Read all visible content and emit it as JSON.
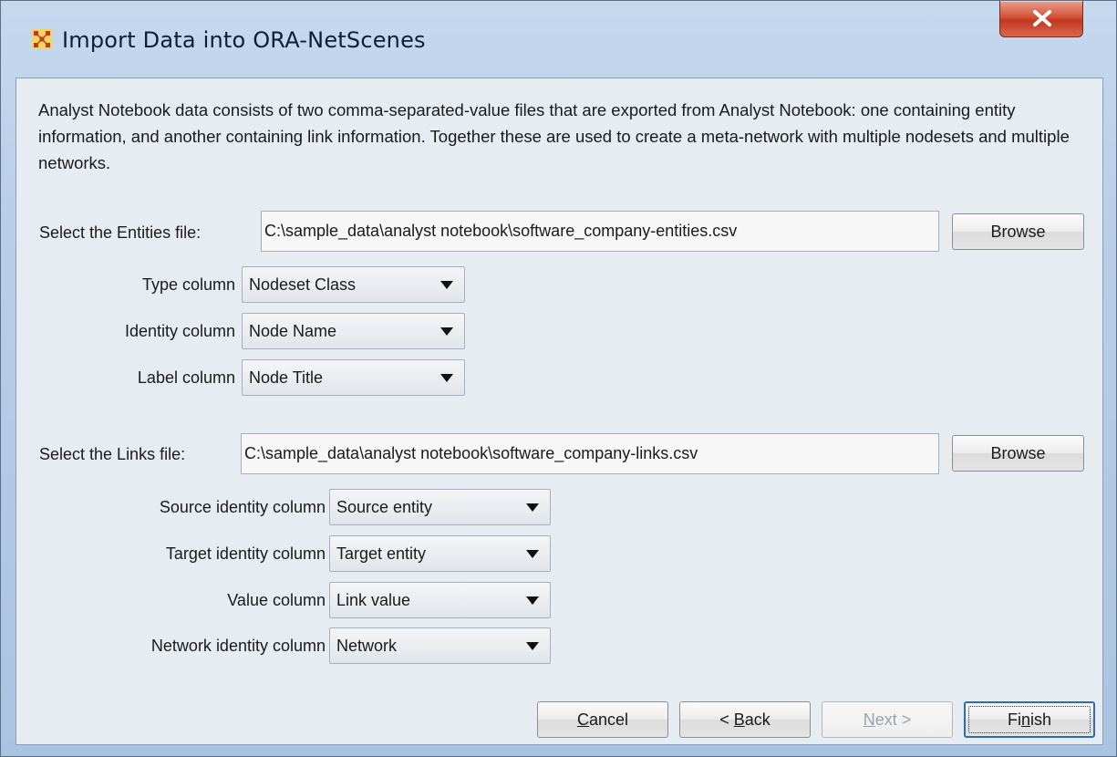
{
  "window": {
    "title": "Import Data into ORA-NetScenes"
  },
  "description": "Analyst Notebook data consists of two comma-separated-value files that are exported from Analyst Notebook: one containing entity information, and another containing link information. Together these are used to create a meta-network with multiple nodesets and multiple networks.",
  "entities": {
    "file_label": "Select the Entities file:",
    "file_value": "C:\\sample_data\\analyst notebook\\software_company-entities.csv",
    "browse_label": "Browse",
    "type_label": "Type column",
    "type_value": "Nodeset Class",
    "identity_label": "Identity column",
    "identity_value": "Node Name",
    "label_label": "Label column",
    "label_value": "Node Title"
  },
  "links": {
    "file_label": "Select the Links file:",
    "file_value": "C:\\sample_data\\analyst notebook\\software_company-links.csv",
    "browse_label": "Browse",
    "source_label": "Source identity column",
    "source_value": "Source entity",
    "target_label": "Target identity column",
    "target_value": "Target entity",
    "value_label": "Value column",
    "value_value": "Link value",
    "network_label": "Network identity column",
    "network_value": "Network"
  },
  "buttons": {
    "cancel": {
      "pre": "",
      "mnemonic": "C",
      "post": "ancel"
    },
    "back": {
      "pre": "< ",
      "mnemonic": "B",
      "post": "ack"
    },
    "next": {
      "pre": "",
      "mnemonic": "N",
      "post": "ext >"
    },
    "finish": {
      "pre": "Fi",
      "mnemonic": "n",
      "post": "ish"
    }
  },
  "icons": {
    "app": "ora-app-icon",
    "close": "close-icon",
    "dropdown": "chevron-down-icon"
  },
  "colors": {
    "default_button_border": "#2d6db4",
    "close_button": "#c2371f",
    "panel": "#e7ecf3"
  }
}
